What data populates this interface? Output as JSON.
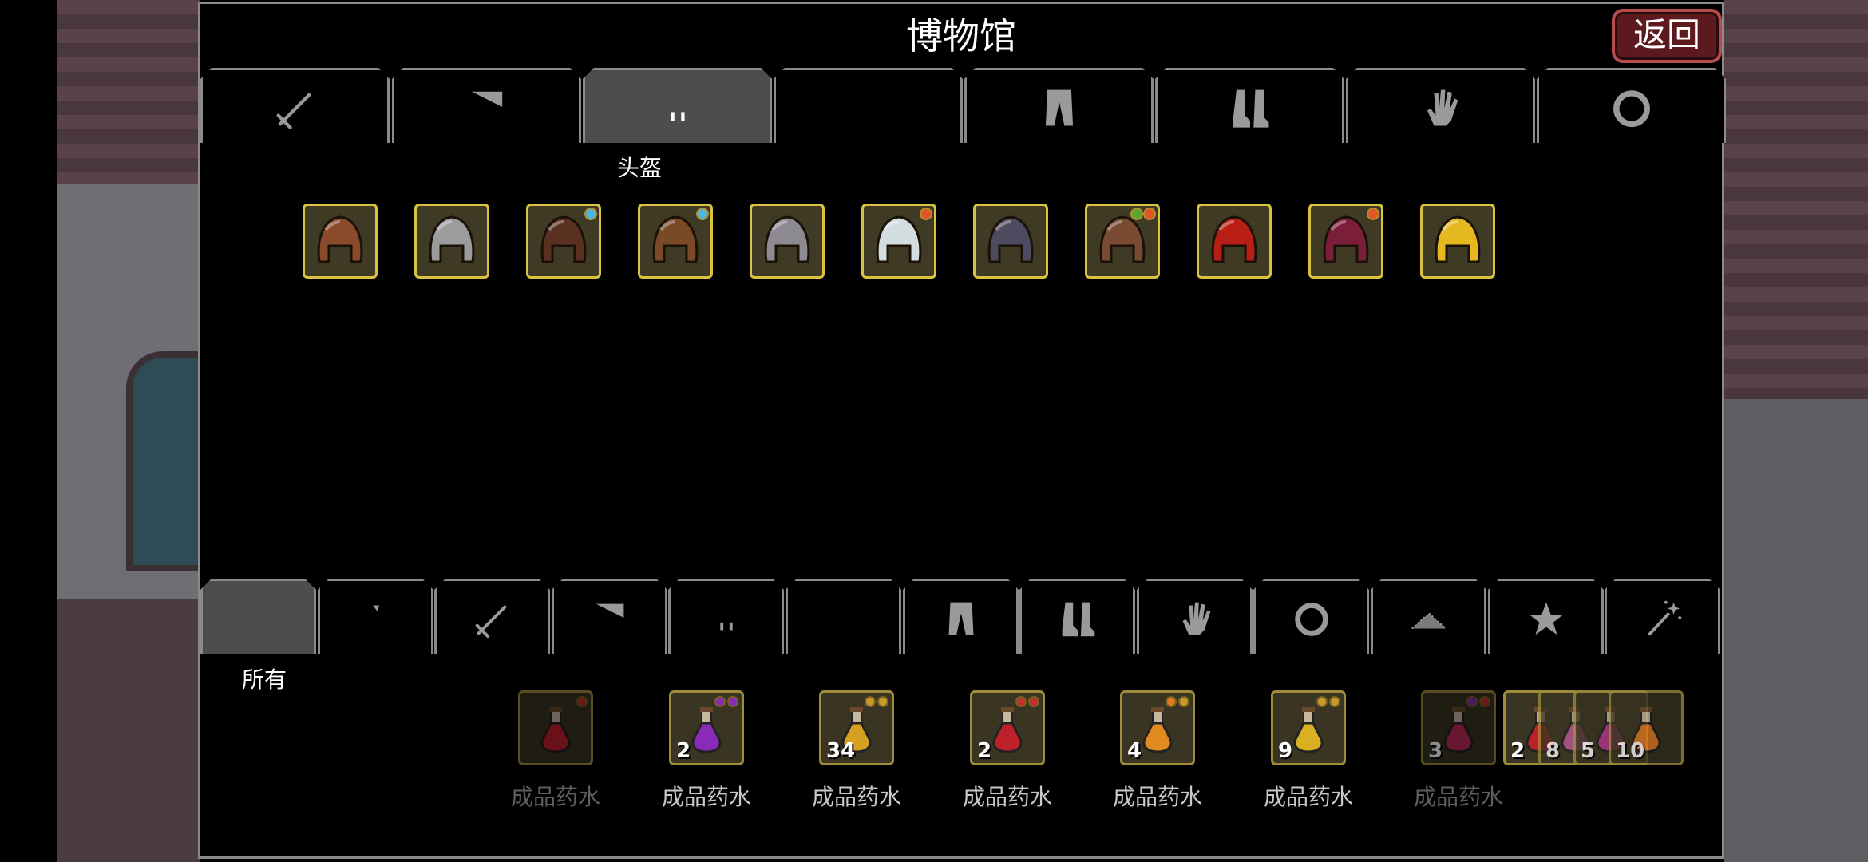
{
  "window": {
    "title": "博物馆",
    "back_label": "返回"
  },
  "equip_tabs": {
    "items": [
      {
        "icon": "sword-icon"
      },
      {
        "icon": "shield-icon"
      },
      {
        "icon": "helmet-icon",
        "active": true
      },
      {
        "icon": "armor-icon"
      },
      {
        "icon": "pants-icon"
      },
      {
        "icon": "boots-icon"
      },
      {
        "icon": "gloves-icon"
      },
      {
        "icon": "ring-icon"
      }
    ],
    "active_label": "头盔"
  },
  "helmets": [
    {
      "name": "leather-hood",
      "color": "#8a4a2a",
      "gems": []
    },
    {
      "name": "iron-mask-helm",
      "color": "#9c9c9c",
      "gems": []
    },
    {
      "name": "spiked-leather-helm",
      "color": "#5a3020",
      "gems": [
        "#4fb6e0"
      ]
    },
    {
      "name": "brown-curl-helm",
      "color": "#7a4a28",
      "gems": [
        "#4fb6e0"
      ]
    },
    {
      "name": "stone-helm",
      "color": "#8e8a92",
      "gems": []
    },
    {
      "name": "white-fur-hood",
      "color": "#d4dde0",
      "gems": [
        "#e0552a"
      ]
    },
    {
      "name": "dark-hood",
      "color": "#4e4a60",
      "gems": []
    },
    {
      "name": "antler-hood",
      "color": "#7a4a32",
      "gems": [
        "#5aa832",
        "#e0552a"
      ]
    },
    {
      "name": "red-knight-helm",
      "color": "#b81e14",
      "gems": []
    },
    {
      "name": "crimson-hood",
      "color": "#7a1e3a",
      "gems": [
        "#e0552a"
      ]
    },
    {
      "name": "gold-knight-helm",
      "color": "#e6b820",
      "gems": []
    }
  ],
  "filter_tabs": {
    "items": [
      {
        "icon": "infinity-icon",
        "active": true
      },
      {
        "icon": "bag-icon"
      },
      {
        "icon": "sword-icon"
      },
      {
        "icon": "shield-icon"
      },
      {
        "icon": "helmet-icon"
      },
      {
        "icon": "armor-icon"
      },
      {
        "icon": "pants-icon"
      },
      {
        "icon": "boots-icon"
      },
      {
        "icon": "gloves-icon"
      },
      {
        "icon": "ring-icon"
      },
      {
        "icon": "cloak-icon"
      },
      {
        "icon": "star-icon"
      },
      {
        "icon": "wand-icon"
      }
    ],
    "active_label": "所有"
  },
  "inventory": [
    {
      "name": "成品药水",
      "count": "",
      "color": "#c0202a",
      "dim": true,
      "badges": [
        "#c03030"
      ]
    },
    {
      "name": "成品药水",
      "count": "2",
      "color": "#8a2ab8",
      "dim": false,
      "badges": [
        "#8a2ab8",
        "#8a2ab8"
      ]
    },
    {
      "name": "成品药水",
      "count": "34",
      "color": "#d8a020",
      "dim": false,
      "badges": [
        "#c89a2a",
        "#c89a2a"
      ]
    },
    {
      "name": "成品药水",
      "count": "2",
      "color": "#c0202a",
      "dim": false,
      "badges": [
        "#c03030",
        "#c03030"
      ]
    },
    {
      "name": "成品药水",
      "count": "4",
      "color": "#e08a20",
      "dim": false,
      "badges": [
        "#e07a20",
        "#c89a2a"
      ]
    },
    {
      "name": "成品药水",
      "count": "9",
      "color": "#d8b020",
      "dim": false,
      "badges": [
        "#c89a2a",
        "#c89a2a"
      ]
    },
    {
      "name": "成品药水",
      "count": "3",
      "color": "#c02a5a",
      "dim": true,
      "badges": [
        "#8a2ab8",
        "#c03030"
      ]
    }
  ],
  "stack": [
    {
      "count": "2",
      "color": "#c0202a"
    },
    {
      "count": "8",
      "color": "#c05a9a"
    },
    {
      "count": "5",
      "color": "#b83a8a"
    },
    {
      "count": "10",
      "color": "#e07a20"
    }
  ]
}
